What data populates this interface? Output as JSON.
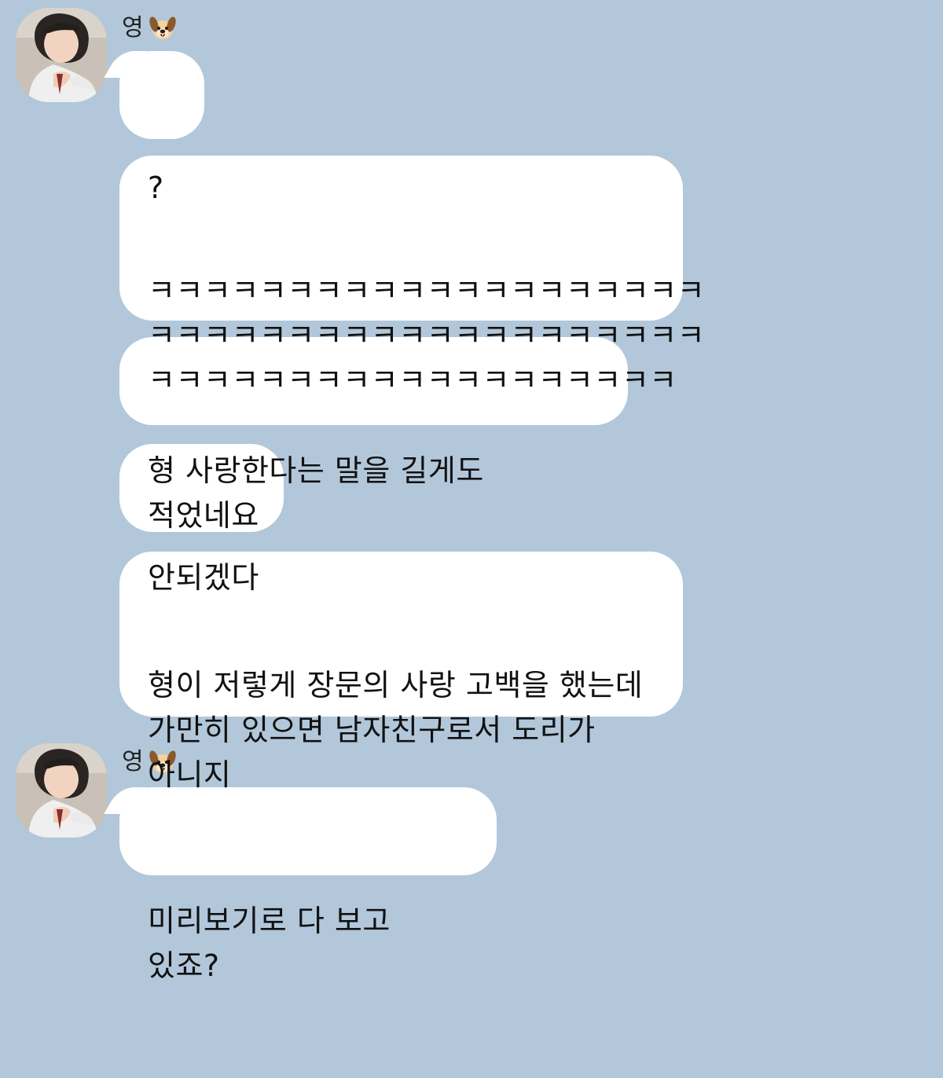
{
  "chat": {
    "sender_name": "영",
    "sender_emoji": "dog-face-icon",
    "messages": [
      {
        "text": "?"
      },
      {
        "text": "ㅋㅋㅋㅋㅋㅋㅋㅋㅋㅋㅋㅋㅋㅋㅋㅋㅋㅋㅋㅋ\nㅋㅋㅋㅋㅋㅋㅋㅋㅋㅋㅋㅋㅋㅋㅋㅋㅋㅋㅋㅋ\nㅋㅋㅋㅋㅋㅋㅋㅋㅋㅋㅋㅋㅋㅋㅋㅋㅋㅋㅋ"
      },
      {
        "text": "형 사랑한다는 말을 길게도 적었네요"
      },
      {
        "text": "안되겠다"
      },
      {
        "text": "형이 저렇게 장문의 사랑 고백을 했는데\n가만히 있으면 남자친구로서 도리가\n아니지"
      },
      {
        "text": "미리보기로 다 보고 있죠?"
      }
    ]
  },
  "colors": {
    "background": "#b2c7da",
    "bubble": "#ffffff",
    "text": "#111111"
  }
}
